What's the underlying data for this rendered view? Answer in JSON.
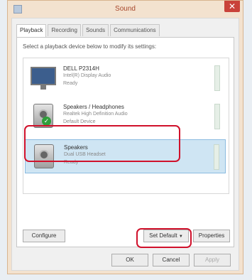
{
  "window": {
    "title": "Sound",
    "close_glyph": "✕"
  },
  "tabs": [
    {
      "label": "Playback",
      "active": true
    },
    {
      "label": "Recording",
      "active": false
    },
    {
      "label": "Sounds",
      "active": false
    },
    {
      "label": "Communications",
      "active": false
    }
  ],
  "instruction": "Select a playback device below to modify its settings:",
  "devices": [
    {
      "name": "DELL P2314H",
      "description": "Intel(R) Display Audio",
      "status": "Ready",
      "icon": "monitor-icon",
      "selected": false,
      "default": false
    },
    {
      "name": "Speakers / Headphones",
      "description": "Realtek High Definition Audio",
      "status": "Default Device",
      "icon": "speaker-icon",
      "selected": false,
      "default": true
    },
    {
      "name": "Speakers",
      "description": "Dual USB Headset",
      "status": "Ready",
      "icon": "speaker-icon",
      "selected": true,
      "default": false
    }
  ],
  "buttons": {
    "configure": "Configure",
    "set_default": "Set Default",
    "set_default_arrow": "▼",
    "properties": "Properties",
    "ok": "OK",
    "cancel": "Cancel",
    "apply": "Apply"
  },
  "colors": {
    "highlight": "#d0112b",
    "selection": "#cfe5f3",
    "close": "#c9423a"
  }
}
